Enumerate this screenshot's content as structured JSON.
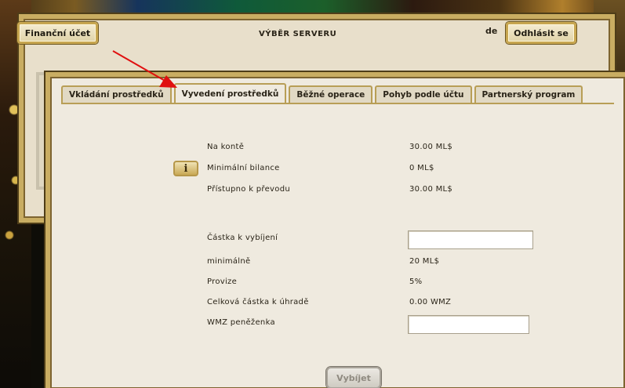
{
  "header": {
    "account_button": "Finanční účet",
    "title": "VÝBĚR SERVERU",
    "language": "de",
    "logout_button": "Odhlásit se"
  },
  "tabs": [
    {
      "label": "Vkládání prostředků",
      "active": false
    },
    {
      "label": "Vyvedení prostředků",
      "active": true
    },
    {
      "label": "Běžné operace",
      "active": false
    },
    {
      "label": "Pohyb podle účtu",
      "active": false
    },
    {
      "label": "Partnerský program",
      "active": false
    }
  ],
  "balance": {
    "on_account_label": "Na kontě",
    "on_account_value": "30.00 ML$",
    "min_balance_label": "Minimální bilance",
    "min_balance_value": "0 ML$",
    "available_label": "Přístupno k převodu",
    "available_value": "30.00 ML$"
  },
  "withdraw_form": {
    "amount_label": "Částka k vybíjení",
    "amount_value": "",
    "minimum_label": "minimálně",
    "minimum_value": "20 ML$",
    "fee_label": "Provize",
    "fee_value": "5%",
    "total_label": "Celková částka k úhradě",
    "total_value": "0.00 WMZ",
    "wallet_label": "WMZ peněženka",
    "wallet_value": "",
    "submit_button": "Vybíjet"
  },
  "info_icon": "info-icon",
  "colors": {
    "gold_frame": "#c9ad62",
    "panel_bg": "#efeadf",
    "annotation_arrow": "#e01010"
  }
}
